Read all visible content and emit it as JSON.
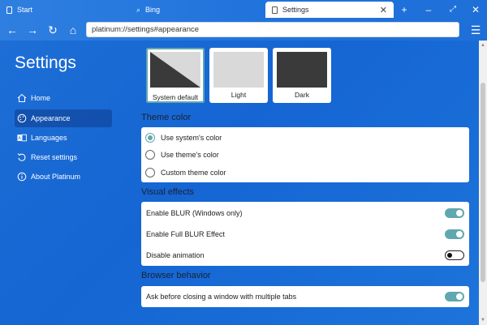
{
  "tabs": [
    {
      "label": "Start"
    },
    {
      "label": "Bing"
    },
    {
      "label": "Settings"
    }
  ],
  "url": "platinum://settings#appearance",
  "sidebar": {
    "title": "Settings",
    "items": [
      {
        "label": "Home",
        "icon": "home-icon"
      },
      {
        "label": "Appearance",
        "icon": "palette-icon"
      },
      {
        "label": "Languages",
        "icon": "language-icon"
      },
      {
        "label": "Reset settings",
        "icon": "reset-icon"
      },
      {
        "label": "About Platinum",
        "icon": "info-icon"
      }
    ]
  },
  "themes": [
    {
      "label": "System default",
      "selected": true
    },
    {
      "label": "Light",
      "selected": false
    },
    {
      "label": "Dark",
      "selected": false
    }
  ],
  "theme_color": {
    "title": "Theme color",
    "options": [
      {
        "label": "Use system's color",
        "checked": true
      },
      {
        "label": "Use theme's color",
        "checked": false
      },
      {
        "label": "Custom theme color",
        "checked": false
      }
    ]
  },
  "visual_effects": {
    "title": "Visual effects",
    "options": [
      {
        "label": "Enable BLUR (Windows only)",
        "on": true
      },
      {
        "label": "Enable Full BLUR Effect",
        "on": true
      },
      {
        "label": "Disable animation",
        "on": false
      }
    ]
  },
  "browser_behavior": {
    "title": "Browser behavior",
    "options": [
      {
        "label": "Ask before closing a window with multiple tabs",
        "on": true
      }
    ]
  },
  "colors": {
    "accent": "#5fa8b0",
    "background": "#1f6fd8"
  }
}
